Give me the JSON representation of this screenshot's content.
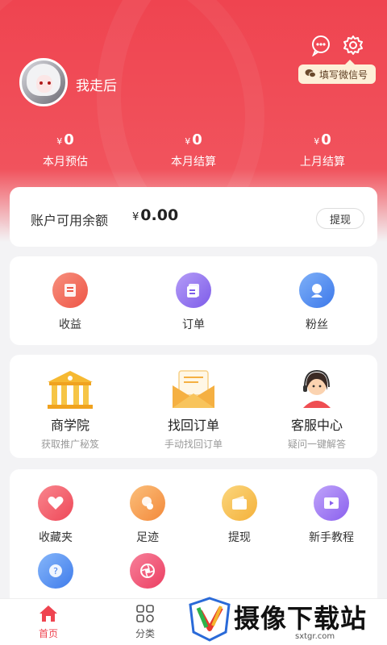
{
  "profile": {
    "username": "我走后"
  },
  "header": {
    "wechat_tip": "填写微信号"
  },
  "stats": [
    {
      "currency": "¥",
      "value": "0",
      "label": "本月预估"
    },
    {
      "currency": "¥",
      "value": "0",
      "label": "本月结算"
    },
    {
      "currency": "¥",
      "value": "0",
      "label": "上月结算"
    }
  ],
  "balance": {
    "label": "账户可用余额",
    "currency": "¥",
    "amount": "0.00",
    "withdraw": "提现"
  },
  "menu1": [
    {
      "label": "收益",
      "icon": "earnings-icon",
      "color": "#f06a5a"
    },
    {
      "label": "订单",
      "icon": "order-icon",
      "color": "#8b6cf0"
    },
    {
      "label": "粉丝",
      "icon": "fans-icon",
      "color": "#4a86ef"
    }
  ],
  "menu2": [
    {
      "title": "商学院",
      "subtitle": "获取推广秘笈",
      "icon": "academy-icon"
    },
    {
      "title": "找回订单",
      "subtitle": "手动找回订单",
      "icon": "envelope-icon"
    },
    {
      "title": "客服中心",
      "subtitle": "疑问一键解答",
      "icon": "customer-service-icon"
    }
  ],
  "menu3": [
    {
      "label": "收藏夹",
      "icon": "heart-icon",
      "color": "#f0566a"
    },
    {
      "label": "足迹",
      "icon": "footprint-icon",
      "color": "#f7a04a"
    },
    {
      "label": "提现",
      "icon": "wallet-icon",
      "color": "#f6c04a"
    },
    {
      "label": "新手教程",
      "icon": "video-icon",
      "color": "#9a6cf0"
    },
    {
      "label": "",
      "icon": "help-icon",
      "color": "#4a86ef"
    },
    {
      "label": "",
      "icon": "aperture-icon",
      "color": "#f0466a"
    }
  ],
  "tabs": [
    {
      "label": "首页",
      "icon": "home-icon",
      "active": true
    },
    {
      "label": "分类",
      "icon": "category-icon",
      "active": false
    }
  ],
  "watermark": {
    "text": "摄像下载站",
    "url": "sxtgr.com"
  },
  "colors": {
    "brand": "#ef4450",
    "active_tab": "#ef4450"
  }
}
